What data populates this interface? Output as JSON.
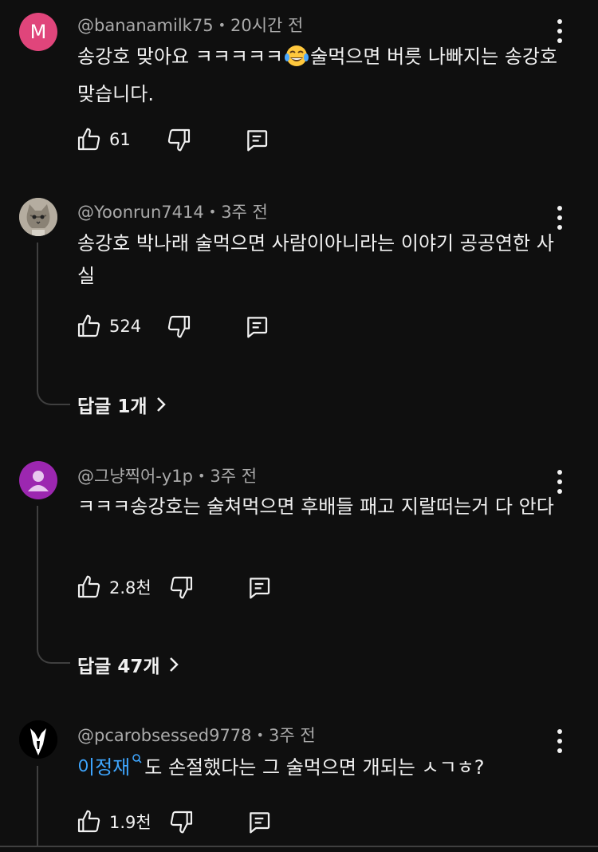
{
  "comments": [
    {
      "avatar_letter": "M",
      "avatar_color": "#e0457b",
      "handle": "@bananamilk75",
      "time": "20시간 전",
      "text_before": "송강호 맞아요 ㅋㅋㅋㅋㅋ",
      "emoji": "face-with-tears-of-joy",
      "text_after": "술먹으면 버릇 나빠지는 송강호 맞습니다.",
      "likes": "61"
    },
    {
      "avatar": "cat-photo",
      "handle": "@Yoonrun7414",
      "time": "3주 전",
      "text": "송강호 박나래 술먹으면 사람이아니라는 이야기 공공연한 사실",
      "likes": "524",
      "replies": "답글 1개"
    },
    {
      "avatar": "default-user",
      "avatar_color": "#9c27b0",
      "handle": "@그냥찍어-y1p",
      "time": "3주 전",
      "text": "ㅋㅋㅋ송강호는 술쳐먹으면 후배들 패고 지랄떠는거 다 안다",
      "likes": "2.8천",
      "replies": "답글 47개"
    },
    {
      "avatar": "suit-figure",
      "handle": "@pcarobsessed9778",
      "time": "3주 전",
      "mention": "이정재",
      "text": "도 손절했다는 그 술먹으면 개되는 ㅅㄱㅎ?",
      "likes": "1.9천"
    }
  ],
  "colors": {
    "background": "#0f0f0f",
    "text": "#f1f1f1",
    "meta": "#aaaaaa",
    "mention": "#3ea6ff",
    "line": "#3f3f3f"
  }
}
